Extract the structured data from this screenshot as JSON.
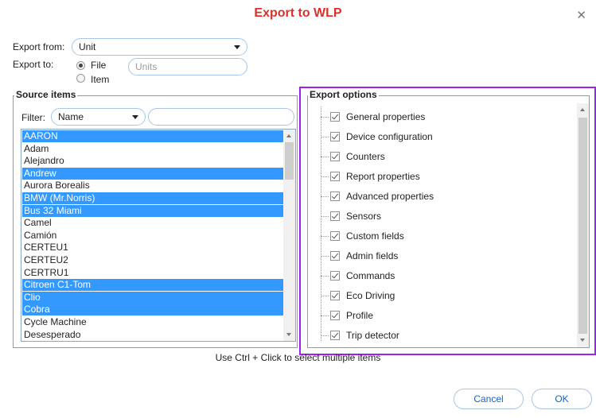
{
  "dialog": {
    "title": "Export to WLP"
  },
  "export_from": {
    "label": "Export from:",
    "value": "Unit"
  },
  "export_to": {
    "label": "Export to:",
    "options": [
      {
        "label": "File",
        "checked": true
      },
      {
        "label": "Item",
        "checked": false
      }
    ],
    "units_placeholder": "Units"
  },
  "source": {
    "legend": "Source items",
    "filter_label": "Filter:",
    "filter_value": "Name",
    "filter_text": "",
    "items": [
      {
        "label": "AARON",
        "selected": true
      },
      {
        "label": "Adam",
        "selected": false
      },
      {
        "label": "Alejandro",
        "selected": false
      },
      {
        "label": "Andrew",
        "selected": true
      },
      {
        "label": "Aurora Borealis",
        "selected": false
      },
      {
        "label": "BMW (Mr.Norris)",
        "selected": true
      },
      {
        "label": "Bus 32 Miami",
        "selected": true
      },
      {
        "label": "Camel",
        "selected": false
      },
      {
        "label": "Camión",
        "selected": false
      },
      {
        "label": "CERTEU1",
        "selected": false
      },
      {
        "label": "CERTEU2",
        "selected": false
      },
      {
        "label": "CERTRU1",
        "selected": false
      },
      {
        "label": "Citroen C1-Tom",
        "selected": true
      },
      {
        "label": "Clio",
        "selected": true
      },
      {
        "label": "Cobra",
        "selected": true
      },
      {
        "label": "Cycle Machine",
        "selected": false
      },
      {
        "label": "Desesperado",
        "selected": false
      }
    ]
  },
  "options": {
    "legend": "Export options",
    "items": [
      "General properties",
      "Device configuration",
      "Counters",
      "Report properties",
      "Advanced properties",
      "Sensors",
      "Custom fields",
      "Admin fields",
      "Commands",
      "Eco Driving",
      "Profile",
      "Trip detector"
    ]
  },
  "hint": "Use Ctrl + Click to select multiple items",
  "buttons": {
    "cancel": "Cancel",
    "ok": "OK"
  },
  "colors": {
    "title": "#d9322b",
    "selection": "#3399ff",
    "highlight": "#a020f0",
    "link": "#1a63b8"
  }
}
